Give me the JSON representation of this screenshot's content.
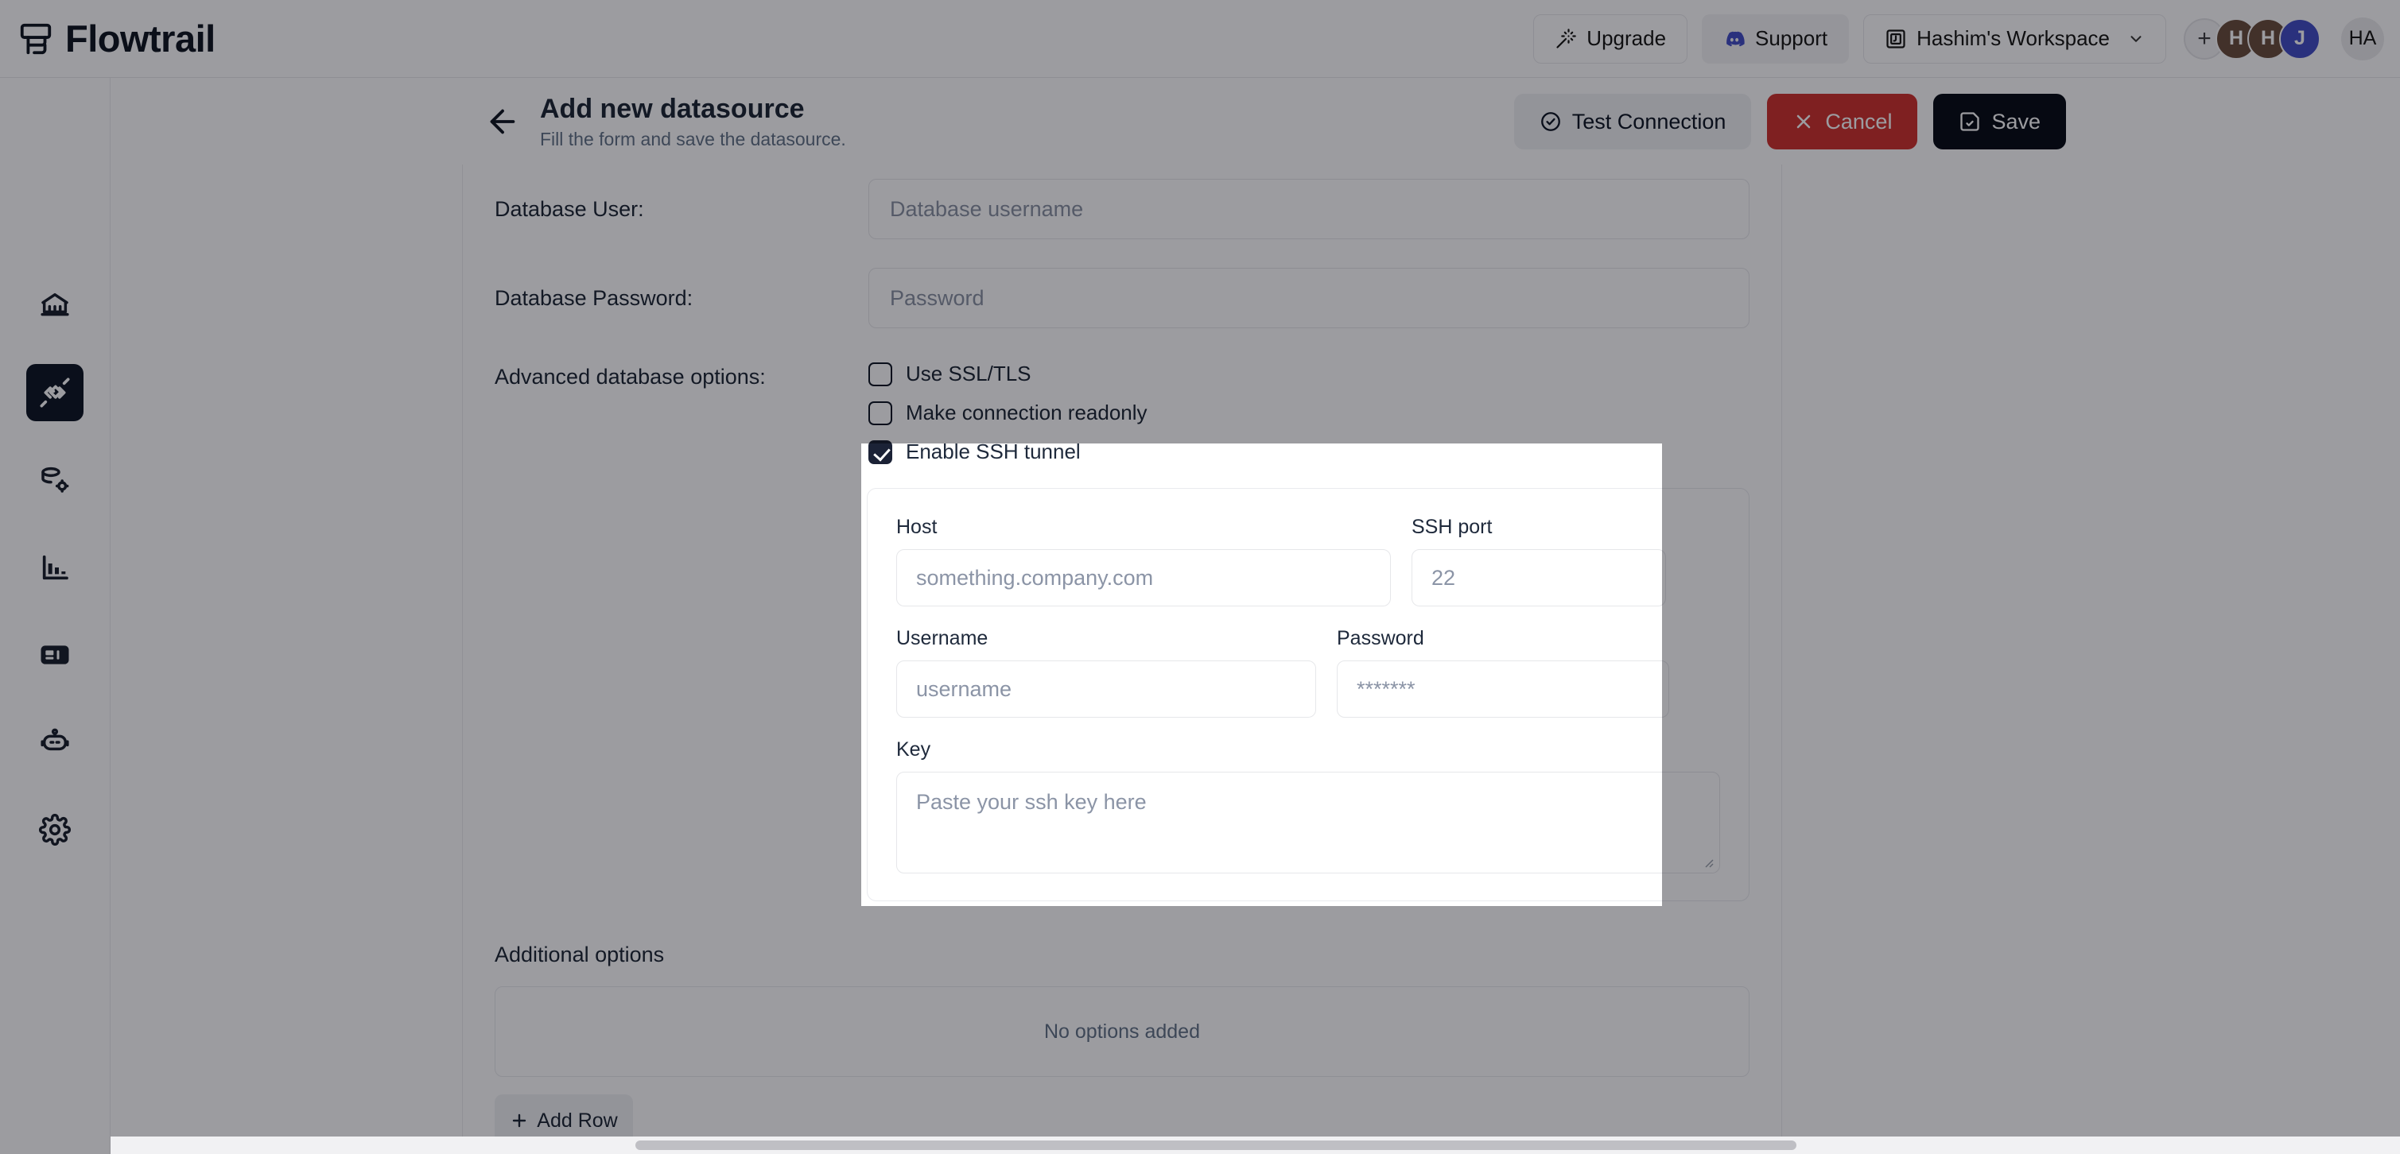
{
  "topbar": {
    "brand": "Flowtrail",
    "brand_icon": "flowtrail-logo-icon",
    "upgrade": {
      "label": "Upgrade",
      "icon": "magic-wand-icon"
    },
    "support": {
      "label": "Support",
      "icon": "discord-icon"
    },
    "workspace": {
      "label": "Hashim's Workspace",
      "icon": "workspace-square-icon",
      "chevron": "chevron-down-icon"
    },
    "avatars": [
      {
        "initial": "+",
        "name": "add-member-avatar",
        "color": "#f4f4f5"
      },
      {
        "initial": "H",
        "name": "avatar-h-1",
        "color": "#6b4f43"
      },
      {
        "initial": "H",
        "name": "avatar-h-2",
        "color": "#6b4f43"
      },
      {
        "initial": "J",
        "name": "avatar-j",
        "color": "#4450c8"
      }
    ],
    "account_avatar": {
      "initial": "HA",
      "color": "#ececee"
    }
  },
  "sidebar": {
    "items": [
      {
        "icon": "home-bank-icon",
        "name": "sidebar-item-home",
        "active": false
      },
      {
        "icon": "plug-connection-icon",
        "name": "sidebar-item-datasources",
        "active": true
      },
      {
        "icon": "database-settings-icon",
        "name": "sidebar-item-database-settings",
        "active": false
      },
      {
        "icon": "bar-chart-icon",
        "name": "sidebar-item-charts",
        "active": false
      },
      {
        "icon": "dashboard-card-icon",
        "name": "sidebar-item-dashboards",
        "active": false
      },
      {
        "icon": "robot-icon",
        "name": "sidebar-item-ai-assistant",
        "active": false
      },
      {
        "icon": "gear-icon",
        "name": "sidebar-item-settings",
        "active": false
      }
    ]
  },
  "page_header": {
    "back_icon": "arrow-left-icon",
    "title": "Add new datasource",
    "subtitle": "Fill the form and save the datasource.",
    "actions": {
      "test": {
        "label": "Test Connection",
        "icon": "check-circle-icon"
      },
      "cancel": {
        "label": "Cancel",
        "icon": "close-x-icon",
        "color": "#cf3434"
      },
      "save": {
        "label": "Save",
        "icon": "save-disk-icon",
        "color": "#090e1c"
      }
    }
  },
  "form": {
    "database_user": {
      "label": "Database User:",
      "value": "",
      "placeholder": "Database username"
    },
    "database_password": {
      "label": "Database Password:",
      "value": "",
      "placeholder": "Password"
    },
    "advanced": {
      "label": "Advanced database options:",
      "options": [
        {
          "label": "Use SSL/TLS",
          "checked": false
        },
        {
          "label": "Make connection readonly",
          "checked": false
        },
        {
          "label": "Enable SSH tunnel",
          "checked": true
        }
      ]
    },
    "ssh": {
      "host": {
        "label": "Host",
        "value": "",
        "placeholder": "something.company.com"
      },
      "port": {
        "label": "SSH port",
        "value": "",
        "placeholder": "22"
      },
      "username": {
        "label": "Username",
        "value": "",
        "placeholder": "username"
      },
      "password": {
        "label": "Password",
        "value": "",
        "placeholder": "*******"
      },
      "key": {
        "label": "Key",
        "value": "",
        "placeholder": "Paste your ssh key here"
      }
    },
    "additional": {
      "title": "Additional options",
      "empty_text": "No options added",
      "add_row": {
        "label": "Add Row",
        "icon": "plus-icon"
      }
    }
  }
}
